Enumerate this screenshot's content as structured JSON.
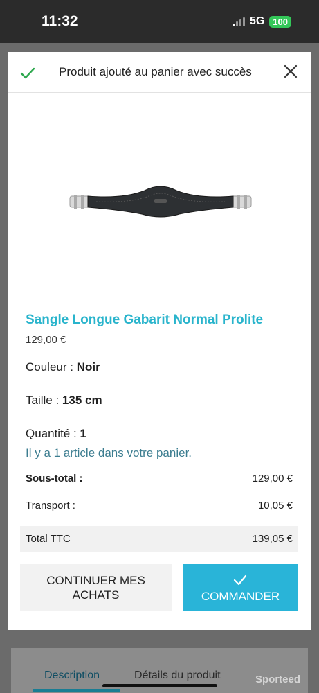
{
  "status_bar": {
    "time": "11:32",
    "network": "5G",
    "battery": "100"
  },
  "modal": {
    "title": "Produit ajouté au panier avec succès",
    "product": {
      "name": "Sangle Longue Gabarit Normal Prolite",
      "price": "129,00 €",
      "color_label": "Couleur : ",
      "color_value": "Noir",
      "size_label": "Taille : ",
      "size_value": "135 cm",
      "qty_label": "Quantité : ",
      "qty_value": "1"
    },
    "cart_note": "Il y a 1 article dans votre panier.",
    "summary": {
      "subtotal_label": "Sous-total :",
      "subtotal_value": "129,00 €",
      "shipping_label": "Transport :",
      "shipping_value": "10,05 €",
      "total_label": "Total TTC",
      "total_value": "139,05 €"
    },
    "buttons": {
      "continue": "CONTINUER MES ACHATS",
      "order": "COMMANDER"
    }
  },
  "background_page": {
    "tabs": [
      "Description",
      "Détails du produit"
    ],
    "watermark": "Sporteed"
  },
  "colors": {
    "accent": "#29b4cc",
    "order_button": "#29b4d8",
    "success_check": "#2fa84f"
  }
}
